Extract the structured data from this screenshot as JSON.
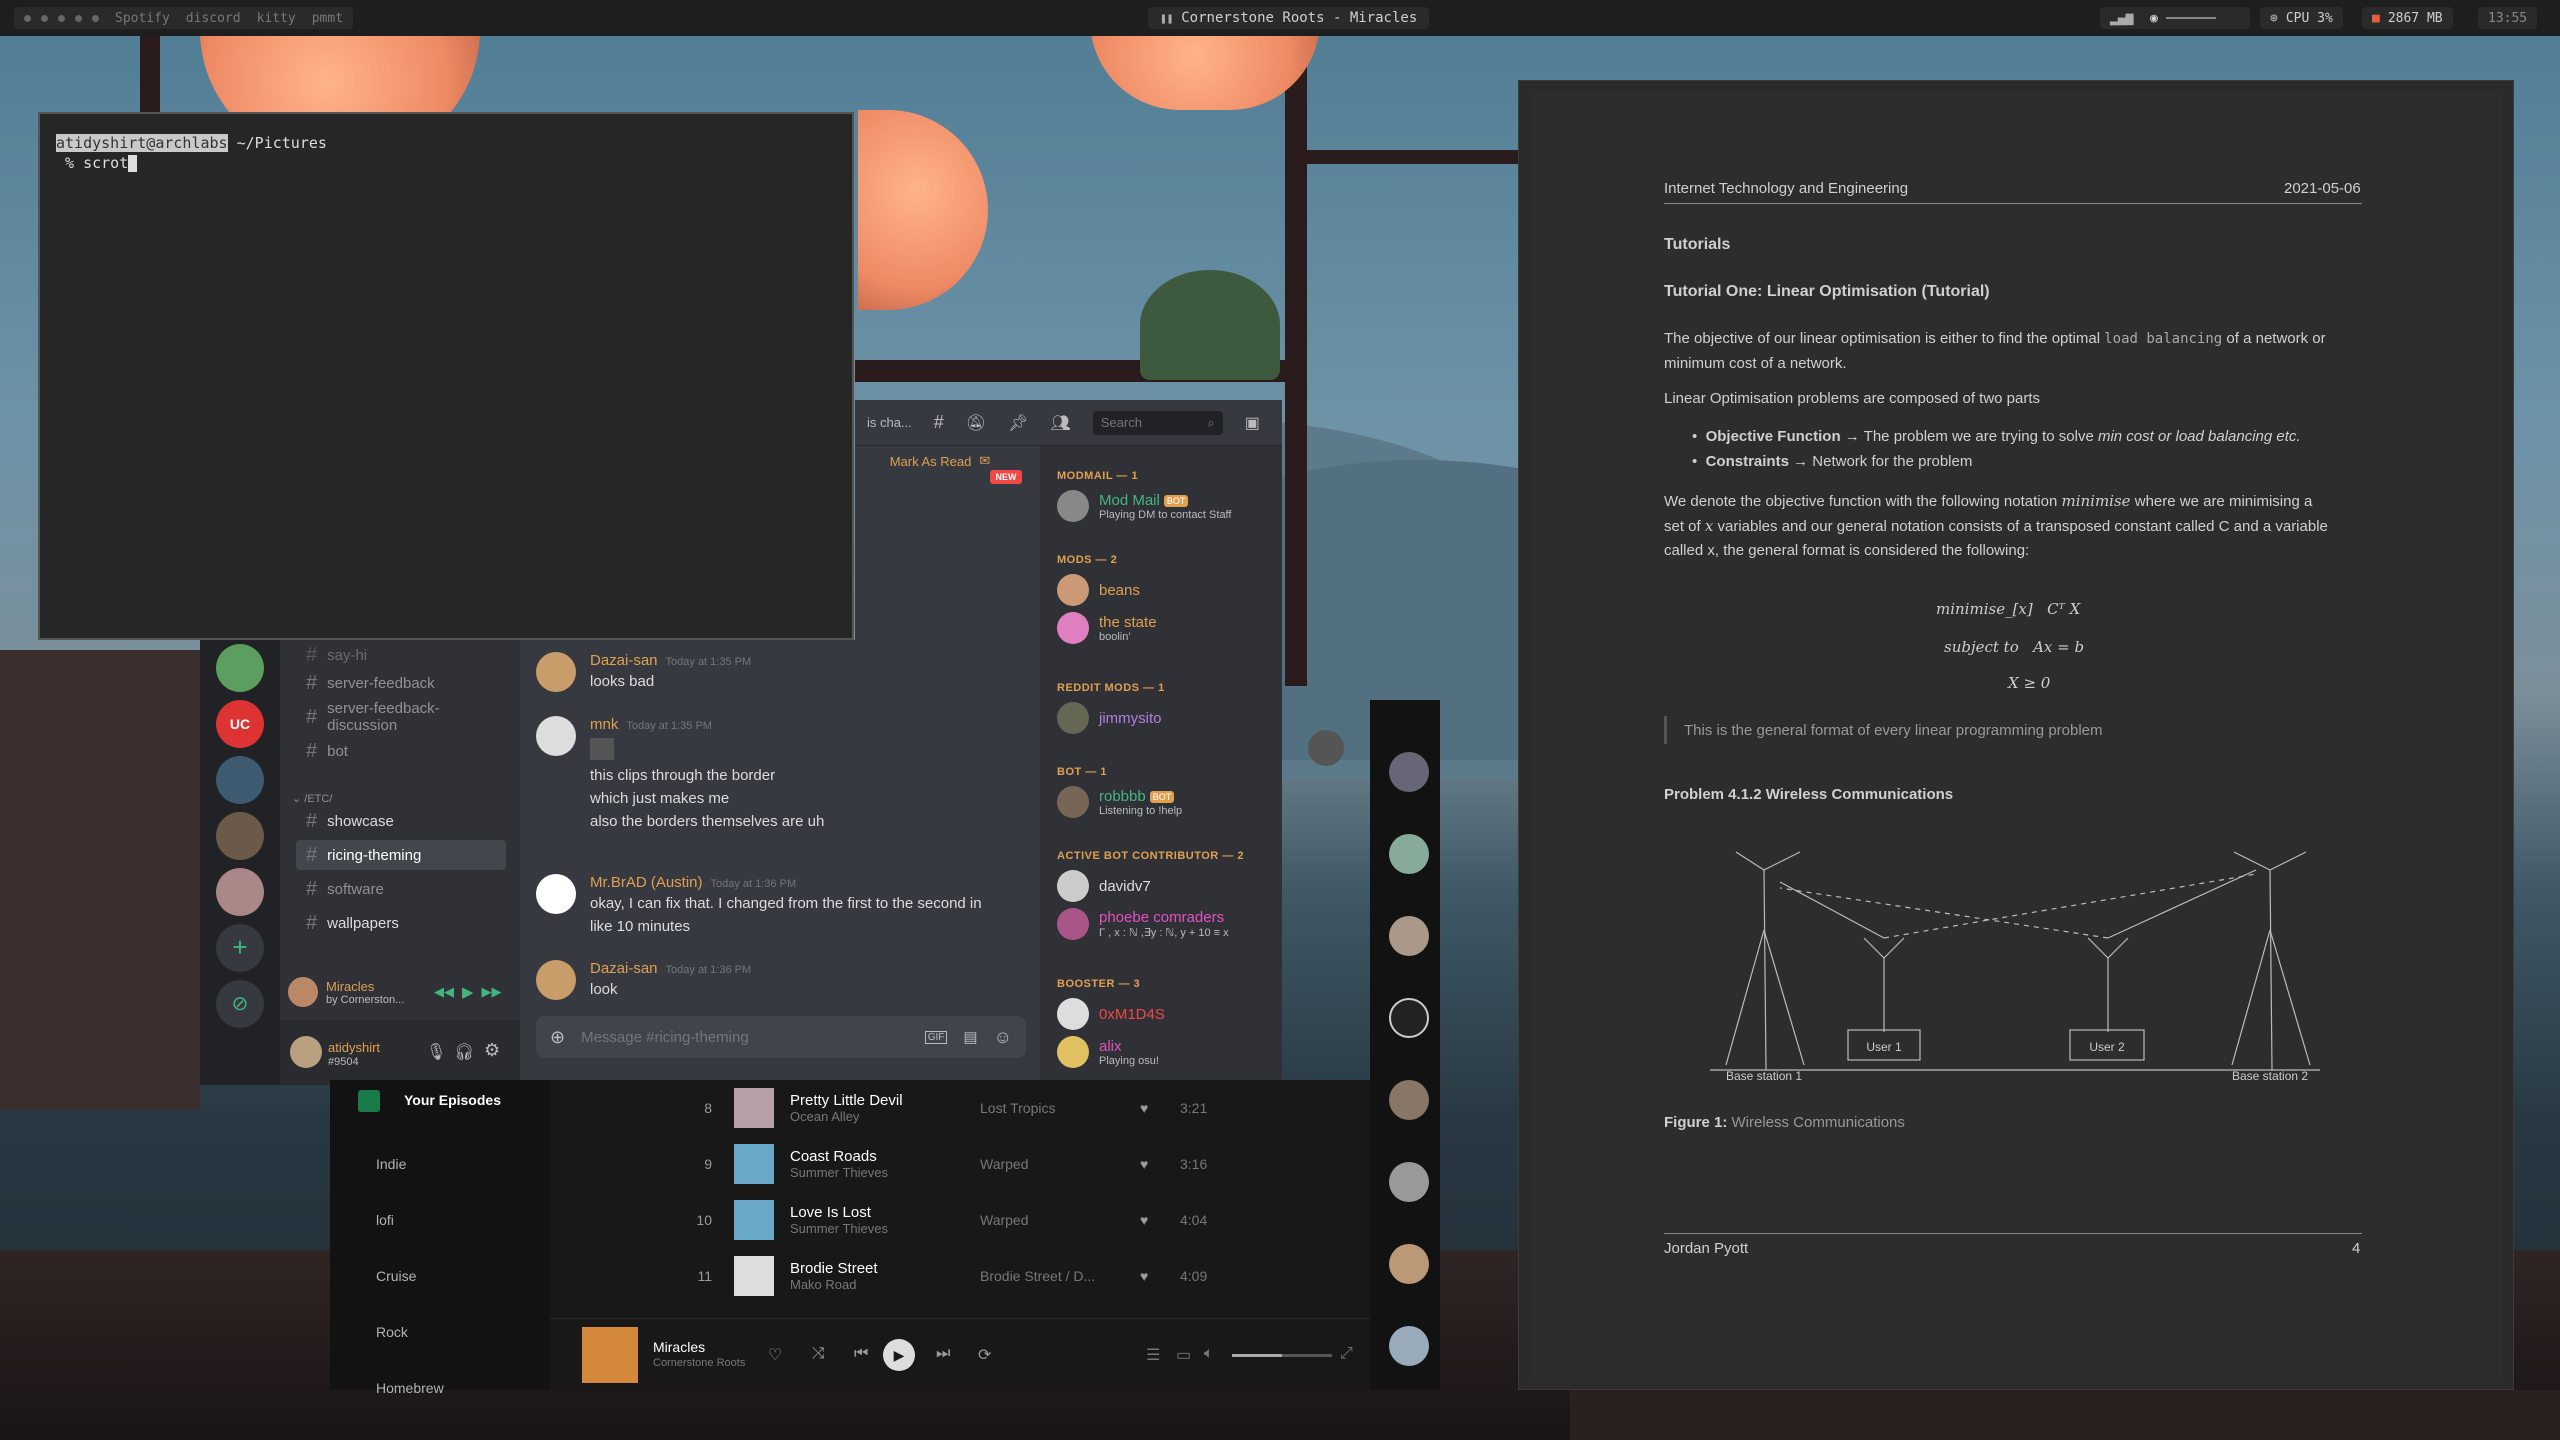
{
  "topbar": {
    "workspaces": [
      "Spotify",
      "discord",
      "kitty",
      "pmmt"
    ],
    "now_playing": "Cornerstone Roots - Miracles",
    "cpu": "CPU 3%",
    "mem": "2867 MB",
    "clock": "13:55"
  },
  "terminal": {
    "user_host": "atidyshirt@archlabs",
    "path": "~/Pictures",
    "command": "% scrot"
  },
  "discord": {
    "header": {
      "channel_trunc": "is cha...",
      "search_placeholder": "Search"
    },
    "mark_as_read": "Mark As Read",
    "new_badge": "NEW",
    "channels": {
      "say_hi": "say-hi",
      "server_feedback": "server-feedback",
      "server_feedback_discussion": "server-feedback-discussion",
      "bot": "bot",
      "category_etc": "/ETC/",
      "showcase": "showcase",
      "ricing_theming": "ricing-theming",
      "software": "software",
      "wallpapers": "wallpapers"
    },
    "now_playing": {
      "title": "Miracles",
      "artist": "by Cornerston..."
    },
    "user": {
      "name": "atidyshirt",
      "tag": "#9504"
    },
    "messages": [
      {
        "author": "Dazai-san",
        "time": "Today at 1:35 PM",
        "lines": [
          "looks bad"
        ]
      },
      {
        "author": "mnk",
        "time": "Today at 1:35 PM",
        "lines": [
          "this clips through the border",
          "which just makes me",
          "also the borders themselves are uh"
        ]
      },
      {
        "author": "Mr.BrAD (Austin)",
        "time": "Today at 1:36 PM",
        "lines": [
          "okay, I can fix that. I changed from the first to the second in",
          "like 10 minutes"
        ]
      },
      {
        "author": "Dazai-san",
        "time": "Today at 1:36 PM",
        "lines": [
          "look"
        ]
      }
    ],
    "message_placeholder": "Message #ricing-theming",
    "gif": "GIF",
    "members": {
      "modmail": {
        "heading": "MODMAIL — 1",
        "name": "Mod Mail",
        "bot": "BOT",
        "status": "Playing DM to contact Staff"
      },
      "mods": {
        "heading": "MODS — 2",
        "m1": "beans",
        "m2": "the state",
        "m2_status": "boolin'"
      },
      "reddit": {
        "heading": "REDDIT MODS — 1",
        "name": "jimmysito"
      },
      "bot": {
        "heading": "BOT — 1",
        "name": "robbbb",
        "bot": "BOT",
        "status": "Listening to !help"
      },
      "abc": {
        "heading": "ACTIVE BOT CONTRIBUTOR — 2",
        "m1": "davidv7",
        "m2": "phoebe comraders",
        "m2_status": "Γ , x : ℕ ,∃y : ℕ, y + 10 ≡ x"
      },
      "booster": {
        "heading": "BOOSTER — 3",
        "m1": "0xM1D4S",
        "m2": "alix",
        "m2_status": "Playing osu!"
      }
    }
  },
  "spotify": {
    "sidebar": [
      "Your Episodes",
      "Indie",
      "lofi",
      "Cruise",
      "Rock",
      "Homebrew"
    ],
    "tracks": [
      {
        "no": "8",
        "title": "Pretty Little Devil",
        "artist": "Ocean Alley",
        "album": "Lost Tropics",
        "dur": "3:21"
      },
      {
        "no": "9",
        "title": "Coast Roads",
        "artist": "Summer Thieves",
        "album": "Warped",
        "dur": "3:16"
      },
      {
        "no": "10",
        "title": "Love Is Lost",
        "artist": "Summer Thieves",
        "album": "Warped",
        "dur": "4:04"
      },
      {
        "no": "11",
        "title": "Brodie Street",
        "artist": "Mako Road",
        "album": "Brodie Street / D...",
        "dur": "4:09"
      }
    ],
    "player": {
      "title": "Miracles",
      "artist": "Cornerstone Roots"
    }
  },
  "document": {
    "course": "Internet Technology and Engineering",
    "date": "2021-05-06",
    "h_tutorials": "Tutorials",
    "h_tutorial_one": "Tutorial One: Linear Optimisation (Tutorial)",
    "p1a": "The objective of our linear optimisation is either to find the optimal",
    "p1code": "load balancing",
    "p1b": "of a network or",
    "p1c": "minimum cost of a network.",
    "p2": "Linear Optimisation problems are composed of two parts",
    "b1_bold": "Objective Function",
    "b1_rest": "→ The problem we are trying to solve",
    "b1_em": "min cost or load balancing etc.",
    "b2_bold": "Constraints",
    "b2_rest": "→ Network for the problem",
    "p3a": "We denote the objective function with the following notation",
    "p3math": "minimise",
    "p3b": "where we are minimising a",
    "p3c": "set of",
    "p3x": "x",
    "p3d": "variables and our general notation consists of a transposed constant called C and a variable",
    "p3e": "called x, the general format is considered the following:",
    "eq1a": "minimise_[x]",
    "eq1b": "Cᵀ X",
    "eq2a": "subject to",
    "eq2b": "Ax = b",
    "eq3": "X ≥ 0",
    "quote": "This is the general format of every linear programming problem",
    "h_problem": "Problem 4.1.2 Wireless Communications",
    "fig_labels": {
      "bs1": "Base station 1",
      "bs2": "Base station 2",
      "u1": "User 1",
      "u2": "User 2"
    },
    "caption_bold": "Figure 1:",
    "caption": "Wireless Communications",
    "author": "Jordan Pyott",
    "page": "4"
  }
}
